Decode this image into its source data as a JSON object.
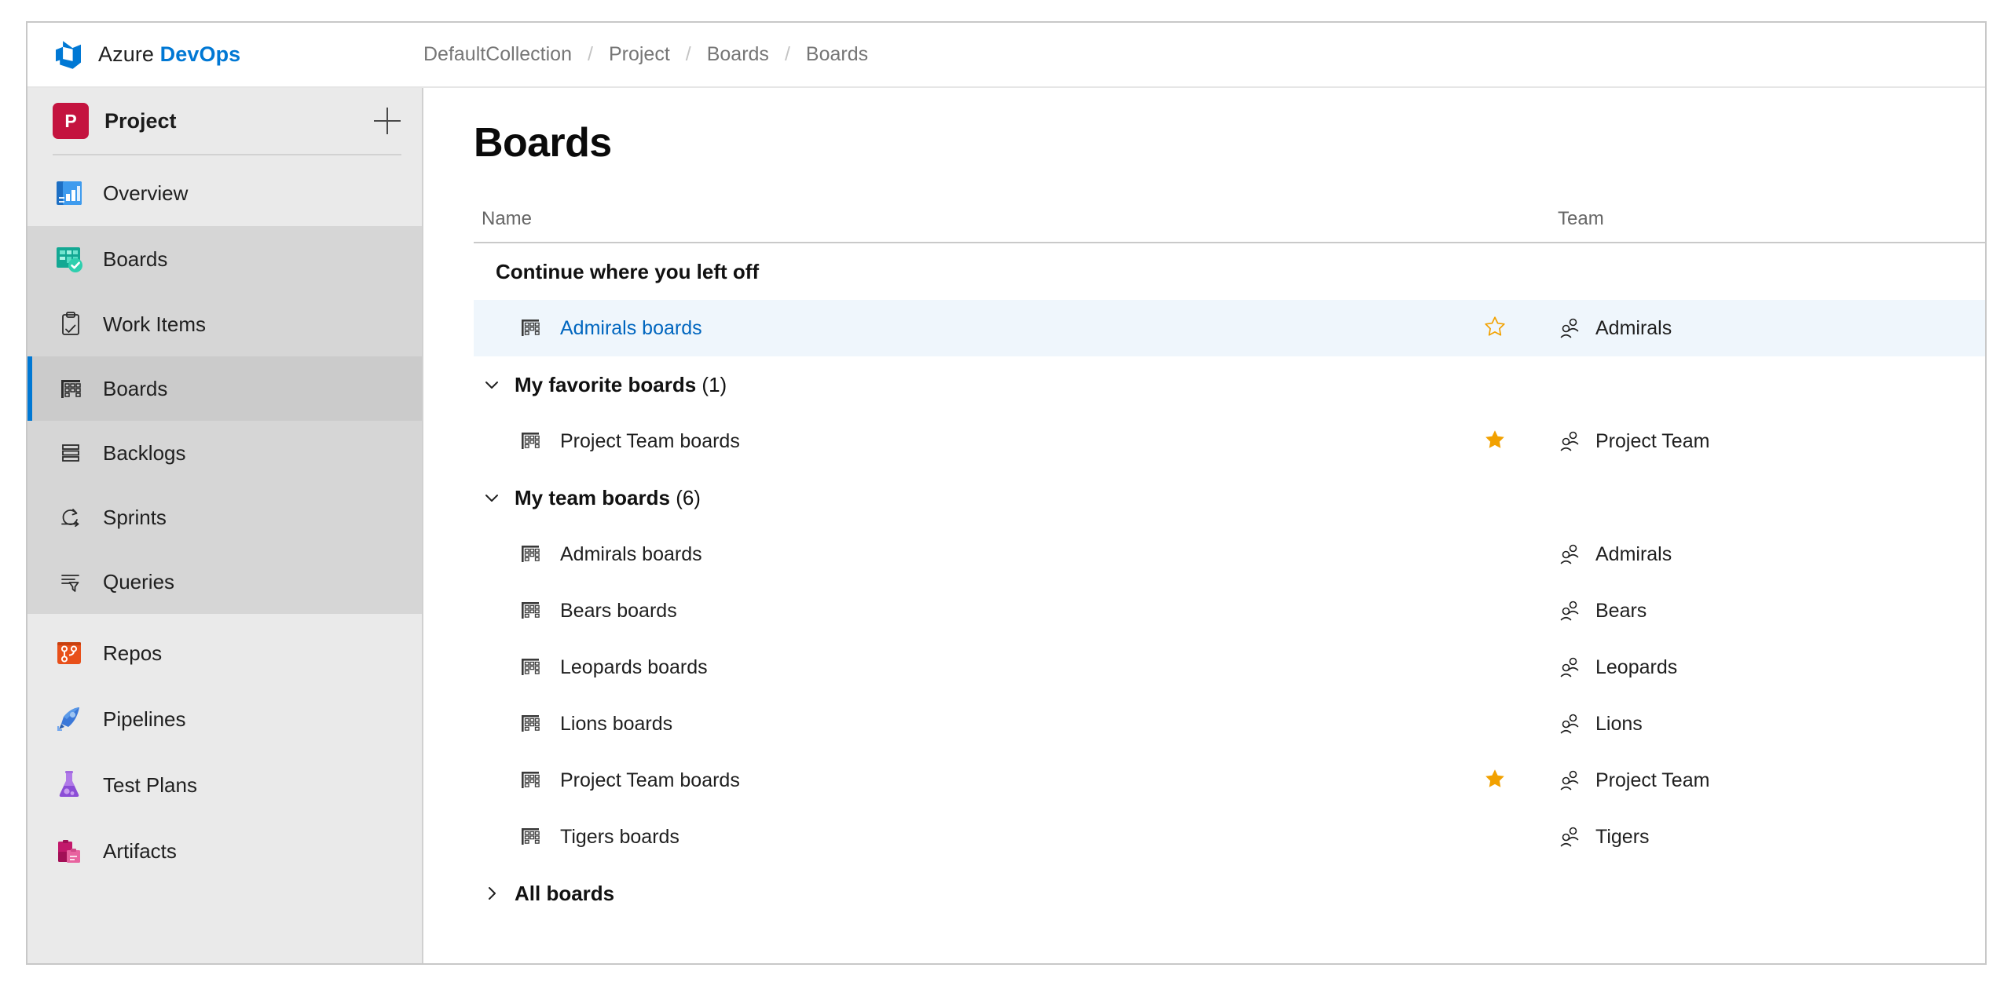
{
  "topbar": {
    "brand_prefix": "Azure ",
    "brand_suffix": "DevOps",
    "logo_icon": "azure-devops-logo",
    "breadcrumb": [
      "DefaultCollection",
      "Project",
      "Boards",
      "Boards"
    ],
    "breadcrumb_separator": "/"
  },
  "sidebar": {
    "project": {
      "initial": "P",
      "name": "Project",
      "avatar_color": "#c4133f",
      "add_icon": "plus-icon"
    },
    "hubs": [
      {
        "label": "Overview",
        "icon": "overview-icon"
      },
      {
        "label": "Boards",
        "icon": "boards-hub-icon"
      }
    ],
    "boards_subitems": [
      {
        "label": "Work Items",
        "icon": "work-items-icon",
        "selected": false
      },
      {
        "label": "Boards",
        "icon": "board-grid-icon",
        "selected": true
      },
      {
        "label": "Backlogs",
        "icon": "backlogs-icon",
        "selected": false
      },
      {
        "label": "Sprints",
        "icon": "sprints-icon",
        "selected": false
      },
      {
        "label": "Queries",
        "icon": "queries-icon",
        "selected": false
      }
    ],
    "hubs_lower": [
      {
        "label": "Repos",
        "icon": "repos-icon"
      },
      {
        "label": "Pipelines",
        "icon": "pipelines-icon"
      },
      {
        "label": "Test Plans",
        "icon": "test-plans-icon"
      },
      {
        "label": "Artifacts",
        "icon": "artifacts-icon"
      }
    ],
    "accent_color": "#0078d4"
  },
  "main": {
    "title": "Boards",
    "columns": {
      "name": "Name",
      "team": "Team"
    },
    "sections": [
      {
        "id": "continue",
        "title": "Continue where you left off",
        "chevron": "none",
        "rows": [
          {
            "name": "Admirals boards",
            "team": "Admirals",
            "favorite": false,
            "star_visible": true,
            "highlighted": true,
            "link": true
          }
        ]
      },
      {
        "id": "favorites",
        "title": "My favorite boards",
        "count": "(1)",
        "chevron": "down",
        "rows": [
          {
            "name": "Project Team boards",
            "team": "Project Team",
            "favorite": true,
            "star_visible": true,
            "highlighted": false,
            "link": false
          }
        ]
      },
      {
        "id": "team-boards",
        "title": "My team boards",
        "count": "(6)",
        "chevron": "down",
        "rows": [
          {
            "name": "Admirals boards",
            "team": "Admirals",
            "favorite": false,
            "star_visible": false,
            "highlighted": false,
            "link": false
          },
          {
            "name": "Bears boards",
            "team": "Bears",
            "favorite": false,
            "star_visible": false,
            "highlighted": false,
            "link": false
          },
          {
            "name": "Leopards boards",
            "team": "Leopards",
            "favorite": false,
            "star_visible": false,
            "highlighted": false,
            "link": false
          },
          {
            "name": "Lions boards",
            "team": "Lions",
            "favorite": false,
            "star_visible": false,
            "highlighted": false,
            "link": false
          },
          {
            "name": "Project Team boards",
            "team": "Project Team",
            "favorite": true,
            "star_visible": true,
            "highlighted": false,
            "link": false
          },
          {
            "name": "Tigers boards",
            "team": "Tigers",
            "favorite": false,
            "star_visible": false,
            "highlighted": false,
            "link": false
          }
        ]
      },
      {
        "id": "all-boards",
        "title": "All boards",
        "chevron": "right",
        "rows": []
      }
    ],
    "icons": {
      "board_row": "board-grid-icon",
      "team": "team-people-icon",
      "star_filled": "star-filled-icon",
      "star_outline": "star-outline-icon"
    },
    "colors": {
      "link": "#0066bf",
      "star": "#f2a100",
      "row_highlight": "#eff6fc"
    }
  }
}
